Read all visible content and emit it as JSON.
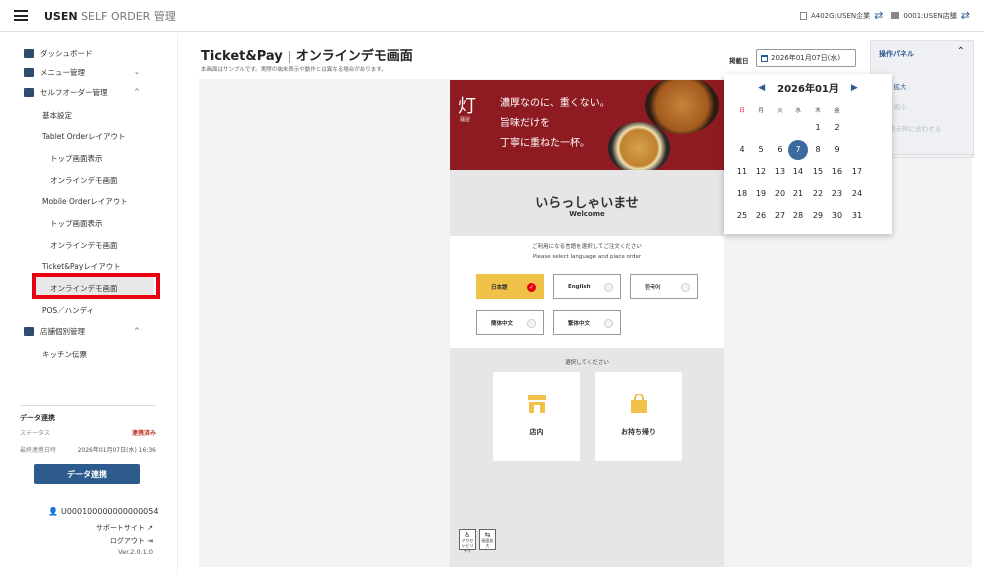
{
  "topbar": {
    "brand_bold": "USEN",
    "brand_light": " SELF ORDER 管理",
    "company": "A402G:USEN企業",
    "store": "0001:USEN店舗"
  },
  "sidebar": {
    "dashboard": "ダッシュボード",
    "menu": "メニュー管理",
    "self_order": "セルフオーダー管理",
    "basic": "基本設定",
    "tablet_layout": "Tablet Orderレイアウト",
    "tablet_top": "トップ画面表示",
    "tablet_demo": "オンラインデモ画面",
    "mobile_layout": "Mobile Orderレイアウト",
    "mobile_top": "トップ画面表示",
    "mobile_demo": "オンラインデモ画面",
    "ticket_layout": "Ticket&Payレイアウト",
    "ticket_demo": "オンラインデモ画面",
    "pos": "POS／ハンディ",
    "store_mgmt": "店舗個別管理",
    "kitchen": "キッチン伝票",
    "sync_title": "データ連携",
    "status_label": "ステータス",
    "status_value": "連携済み",
    "last_sync_label": "最終連携日時",
    "last_sync_value": "2026年01月07日(水) 16:36",
    "sync_button": "データ連携",
    "user_id": "U000100000000000054",
    "support": "サポートサイト",
    "logout": "ログアウト",
    "version": "Ver.2.0.1.0"
  },
  "main": {
    "title": "Ticket&Pay",
    "subtitle": "オンラインデモ画面",
    "note": "本画面はサンプルです。実際の端末表示や動作とは異なる場合があります。",
    "date_label": "掲載日",
    "date_value": "2026年01月07日(水)"
  },
  "ops": {
    "title": "操作パネル",
    "zoom_in": "拡大",
    "zoom_out": "縮小",
    "fit": "表示枠に合わせる"
  },
  "kiosk": {
    "logo_kanji": "灯",
    "logo_sub": "麺屋",
    "copy1": "濃厚なのに、重くない。",
    "copy2": "旨味だけを",
    "copy3": "丁寧に重ねた一杯。",
    "welcome_jp": "いらっしゃいませ",
    "welcome_en": "Welcome",
    "lang_prompt_jp": "ご利用になる言語を選択してご注文ください",
    "lang_prompt_en": "Please select language and place order",
    "lang_ja": "日本語",
    "lang_en": "English",
    "lang_ko": "한국어",
    "lang_zh_s": "簡体中文",
    "lang_zh_t": "繁体中文",
    "eat_prompt": "選択してください",
    "eat_in": "店内",
    "take_out": "お持ち帰り",
    "a11y_label": "アクセシビリティ",
    "reset_label": "画面拡大"
  },
  "calendar": {
    "month_label": "2026年01月",
    "dow": [
      "日",
      "月",
      "火",
      "水",
      "木",
      "金"
    ],
    "selected_day": "7",
    "rows": [
      [
        "",
        "",
        "",
        "",
        "1",
        "2"
      ],
      [
        "4",
        "5",
        "6",
        "7",
        "8",
        "9"
      ],
      [
        "11",
        "12",
        "13",
        "14",
        "15",
        "16",
        "17"
      ],
      [
        "18",
        "19",
        "20",
        "21",
        "22",
        "23",
        "24"
      ],
      [
        "25",
        "26",
        "27",
        "28",
        "29",
        "30",
        "31"
      ]
    ]
  },
  "colors": {
    "accent": "#2d5b8e",
    "highlight": "#e60012",
    "banner": "#8e1b21",
    "lang_selected": "#f0c249",
    "eat_icon": "#f0c249"
  }
}
